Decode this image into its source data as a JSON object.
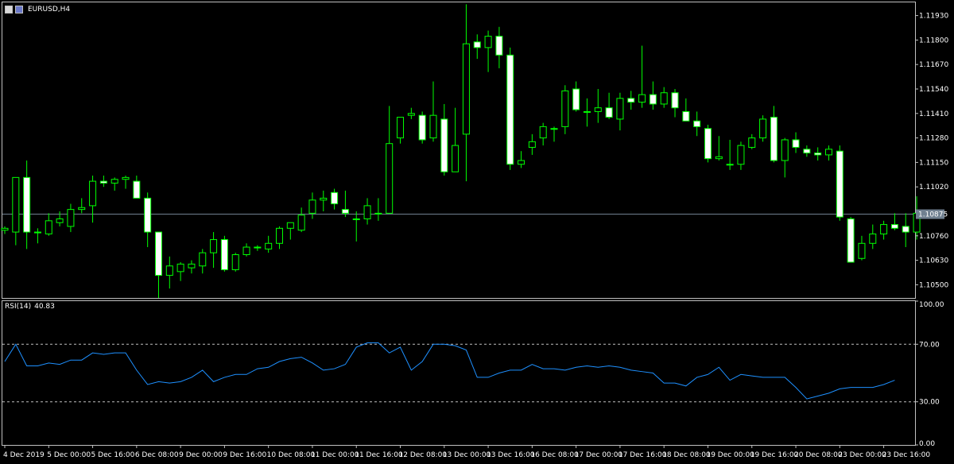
{
  "window": {
    "symbol_label": "EURUSD,H4"
  },
  "colors": {
    "background": "#000000",
    "frame": "#c0c0c0",
    "bull": "#00ff00",
    "bear_body": "#ffffff",
    "bid_line": "#708090",
    "rsi_line": "#1e90ff",
    "text": "#ffffff",
    "level_line": "#c0c0c0"
  },
  "chart_data": [
    {
      "type": "candlestick",
      "title": "EURUSD,H4",
      "ylim": [
        1.1043,
        1.12
      ],
      "y_tick_labels": [
        "1.11930",
        "1.11800",
        "1.11670",
        "1.11540",
        "1.11410",
        "1.11280",
        "1.11150",
        "1.11020",
        "1.10760",
        "1.10630",
        "1.10500"
      ],
      "y_ticks": [
        1.1193,
        1.118,
        1.1167,
        1.1154,
        1.1141,
        1.1128,
        1.1115,
        1.1102,
        1.1076,
        1.1063,
        1.105
      ],
      "bid": {
        "value": 1.10875,
        "label": "1.10875"
      },
      "grid": false,
      "candles": [
        [
          1.1079,
          1.1081,
          1.1077,
          1.108
        ],
        [
          1.1078,
          1.1107,
          1.1071,
          1.1107
        ],
        [
          1.1107,
          1.1116,
          1.1069,
          1.1078
        ],
        [
          1.1078,
          1.108,
          1.1072,
          1.1078
        ],
        [
          1.1077,
          1.1088,
          1.1076,
          1.1084
        ],
        [
          1.1083,
          1.1089,
          1.1081,
          1.1085
        ],
        [
          1.1081,
          1.1093,
          1.1078,
          1.109
        ],
        [
          1.109,
          1.1096,
          1.1088,
          1.1091
        ],
        [
          1.1092,
          1.1108,
          1.1083,
          1.1105
        ],
        [
          1.1105,
          1.1108,
          1.1102,
          1.1104
        ],
        [
          1.1104,
          1.1107,
          1.11,
          1.1106
        ],
        [
          1.1106,
          1.1108,
          1.1101,
          1.1107
        ],
        [
          1.1105,
          1.1108,
          1.1096,
          1.1096
        ],
        [
          1.1096,
          1.1099,
          1.107,
          1.1078
        ],
        [
          1.1078,
          1.1078,
          1.1043,
          1.1055
        ],
        [
          1.1055,
          1.1065,
          1.1048,
          1.106
        ],
        [
          1.1057,
          1.1062,
          1.1052,
          1.1061
        ],
        [
          1.1059,
          1.1063,
          1.1056,
          1.1061
        ],
        [
          1.106,
          1.1069,
          1.1056,
          1.1067
        ],
        [
          1.1067,
          1.1078,
          1.1059,
          1.1074
        ],
        [
          1.1074,
          1.1076,
          1.1057,
          1.1058
        ],
        [
          1.1058,
          1.1067,
          1.1057,
          1.1066
        ],
        [
          1.1066,
          1.1072,
          1.1065,
          1.107
        ],
        [
          1.107,
          1.1071,
          1.1068,
          1.107
        ],
        [
          1.1069,
          1.1076,
          1.1067,
          1.1072
        ],
        [
          1.1072,
          1.1081,
          1.1069,
          1.108
        ],
        [
          1.108,
          1.1082,
          1.1074,
          1.1083
        ],
        [
          1.1079,
          1.1091,
          1.1078,
          1.1087
        ],
        [
          1.1088,
          1.1099,
          1.1085,
          1.1095
        ],
        [
          1.1095,
          1.11,
          1.1089,
          1.1096
        ],
        [
          1.1099,
          1.1101,
          1.109,
          1.1093
        ],
        [
          1.109,
          1.11,
          1.1086,
          1.1088
        ],
        [
          1.1085,
          1.1089,
          1.1073,
          1.1085
        ],
        [
          1.1085,
          1.1096,
          1.1082,
          1.1092
        ],
        [
          1.1088,
          1.1096,
          1.1084,
          1.1088
        ],
        [
          1.1088,
          1.1145,
          1.1088,
          1.1125
        ],
        [
          1.1128,
          1.1139,
          1.1125,
          1.1139
        ],
        [
          1.114,
          1.1144,
          1.1138,
          1.1141
        ],
        [
          1.114,
          1.1142,
          1.1125,
          1.1127
        ],
        [
          1.1128,
          1.1158,
          1.1126,
          1.114
        ],
        [
          1.1138,
          1.1146,
          1.1108,
          1.111
        ],
        [
          1.111,
          1.1144,
          1.1112,
          1.1124
        ],
        [
          1.113,
          1.1199,
          1.1105,
          1.1178
        ],
        [
          1.1179,
          1.1183,
          1.117,
          1.1176
        ],
        [
          1.1176,
          1.1185,
          1.1163,
          1.1182
        ],
        [
          1.1182,
          1.1187,
          1.1165,
          1.1172
        ],
        [
          1.1172,
          1.1176,
          1.1111,
          1.1114
        ],
        [
          1.1114,
          1.1121,
          1.1112,
          1.1116
        ],
        [
          1.1123,
          1.113,
          1.1119,
          1.1126
        ],
        [
          1.1128,
          1.1136,
          1.1124,
          1.1134
        ],
        [
          1.1133,
          1.1134,
          1.1126,
          1.1133
        ],
        [
          1.1134,
          1.1156,
          1.113,
          1.1153
        ],
        [
          1.1154,
          1.1158,
          1.1142,
          1.1143
        ],
        [
          1.1142,
          1.1149,
          1.1134,
          1.1142
        ],
        [
          1.1142,
          1.1154,
          1.1136,
          1.1144
        ],
        [
          1.1144,
          1.1152,
          1.1138,
          1.1139
        ],
        [
          1.1138,
          1.1152,
          1.1132,
          1.1149
        ],
        [
          1.1149,
          1.1153,
          1.1143,
          1.1147
        ],
        [
          1.1147,
          1.1177,
          1.1144,
          1.1151
        ],
        [
          1.1151,
          1.1158,
          1.1143,
          1.1146
        ],
        [
          1.1146,
          1.1155,
          1.1144,
          1.1152
        ],
        [
          1.1152,
          1.1154,
          1.1139,
          1.1144
        ],
        [
          1.1142,
          1.1149,
          1.1137,
          1.1137
        ],
        [
          1.1137,
          1.1142,
          1.1129,
          1.1134
        ],
        [
          1.1133,
          1.1135,
          1.1115,
          1.1117
        ],
        [
          1.1117,
          1.1129,
          1.1116,
          1.1118
        ],
        [
          1.1114,
          1.1127,
          1.1111,
          1.1114
        ],
        [
          1.1114,
          1.1126,
          1.1111,
          1.1124
        ],
        [
          1.1123,
          1.113,
          1.1122,
          1.1128
        ],
        [
          1.1128,
          1.114,
          1.1126,
          1.1138
        ],
        [
          1.1139,
          1.1145,
          1.1115,
          1.1116
        ],
        [
          1.1116,
          1.1128,
          1.1107,
          1.1127
        ],
        [
          1.1127,
          1.1131,
          1.112,
          1.1123
        ],
        [
          1.1122,
          1.1124,
          1.1118,
          1.112
        ],
        [
          1.112,
          1.1123,
          1.1116,
          1.1119
        ],
        [
          1.1119,
          1.1124,
          1.1116,
          1.1122
        ],
        [
          1.1121,
          1.1124,
          1.1084,
          1.1086
        ],
        [
          1.1085,
          1.1086,
          1.1062,
          1.1062
        ],
        [
          1.1064,
          1.1076,
          1.1063,
          1.1072
        ],
        [
          1.1072,
          1.1082,
          1.1069,
          1.1077
        ],
        [
          1.1077,
          1.1084,
          1.1074,
          1.1082
        ],
        [
          1.1082,
          1.1088,
          1.1079,
          1.108
        ],
        [
          1.1081,
          1.1088,
          1.107,
          1.1078
        ],
        [
          1.1078,
          1.1097,
          1.1074,
          1.1088
        ]
      ],
      "x_tick_labels": [
        "4 Dec 2019",
        "5 Dec 00:00",
        "5 Dec 16:00",
        "6 Dec 08:00",
        "9 Dec 00:00",
        "9 Dec 16:00",
        "10 Dec 08:00",
        "11 Dec 00:00",
        "11 Dec 16:00",
        "12 Dec 08:00",
        "13 Dec 00:00",
        "13 Dec 16:00",
        "16 Dec 08:00",
        "17 Dec 00:00",
        "17 Dec 16:00",
        "18 Dec 08:00",
        "19 Dec 00:00",
        "19 Dec 16:00",
        "20 Dec 08:00",
        "23 Dec 00:00",
        "23 Dec 16:00"
      ],
      "x_tick_index": [
        0,
        4,
        8,
        12,
        16,
        20,
        24,
        28,
        32,
        36,
        40,
        44,
        48,
        52,
        56,
        60,
        64,
        68,
        72,
        76,
        80
      ]
    },
    {
      "type": "line",
      "title": "RSI(14) 40.83",
      "indicator_label": "RSI(14)",
      "indicator_value": "40.83",
      "ylim": [
        0,
        100
      ],
      "y_tick_labels": [
        "100.00",
        "70.00",
        "30.00",
        "0.00"
      ],
      "y_ticks": [
        100,
        70,
        30,
        0
      ],
      "levels": [
        70,
        30
      ],
      "values": [
        58,
        70,
        55,
        55,
        57,
        56,
        59,
        59,
        64,
        63,
        64,
        64,
        52,
        42,
        44,
        43,
        44,
        47,
        52,
        44,
        47,
        49,
        49,
        53,
        54,
        58,
        60,
        61,
        57,
        52,
        53,
        56,
        68,
        71,
        71,
        64,
        68,
        52,
        58,
        70,
        70,
        69,
        66,
        47,
        47,
        50,
        52,
        52,
        56,
        53,
        53,
        52,
        54,
        55,
        54,
        55,
        54,
        52,
        51,
        50,
        43,
        43,
        41,
        47,
        49,
        54,
        45,
        49,
        48,
        47,
        47,
        47,
        40,
        32,
        34,
        36,
        39,
        40,
        40,
        40,
        42,
        45
      ]
    }
  ]
}
